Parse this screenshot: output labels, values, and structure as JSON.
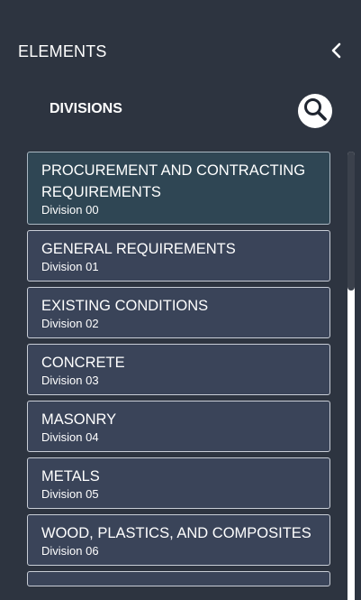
{
  "header": {
    "title": "ELEMENTS",
    "collapse_icon": "chevron-left-icon"
  },
  "section": {
    "title": "DIVISIONS",
    "search_icon": "search-icon"
  },
  "divisions": [
    {
      "name": "PROCUREMENT AND CONTRACTING REQUIREMENTS",
      "division": "Division 00",
      "selected": true
    },
    {
      "name": "GENERAL REQUIREMENTS",
      "division": "Division 01",
      "selected": false
    },
    {
      "name": "EXISTING CONDITIONS",
      "division": "Division 02",
      "selected": false
    },
    {
      "name": "CONCRETE",
      "division": "Division 03",
      "selected": false
    },
    {
      "name": "MASONRY",
      "division": "Division 04",
      "selected": false
    },
    {
      "name": "METALS",
      "division": "Division 05",
      "selected": false
    },
    {
      "name": "WOOD, PLASTICS, AND COMPOSITES",
      "division": "Division 06",
      "selected": false
    },
    {
      "name": "",
      "division": "",
      "selected": false
    }
  ],
  "colors": {
    "background": "#2d3440",
    "item_background": "#3a4459",
    "item_selected_background": "#2f4654",
    "item_border": "#c8cdd6"
  }
}
